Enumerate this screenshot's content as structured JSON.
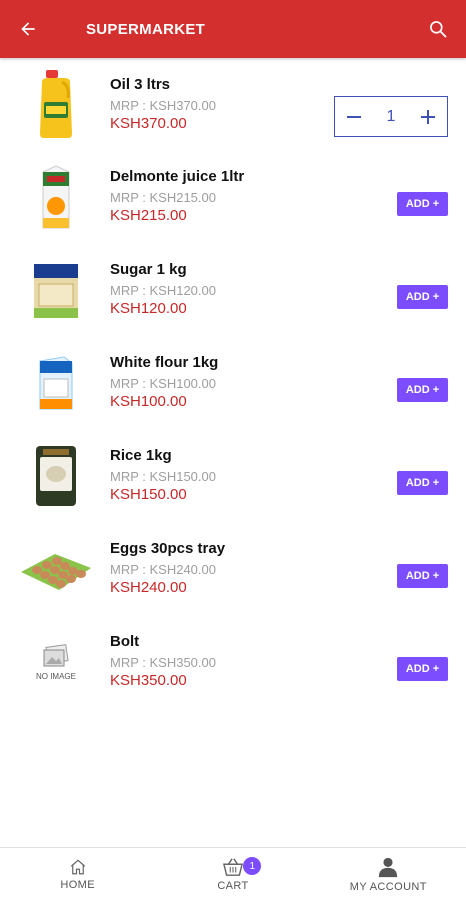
{
  "header": {
    "title": "SUPERMARKET",
    "background_color": "#d32f2f"
  },
  "products": [
    {
      "name": "Oil 3 ltrs",
      "mrp": "MRP :  KSH370.00",
      "price": "KSH370.00",
      "in_cart": true,
      "quantity": "1"
    },
    {
      "name": "Delmonte juice 1ltr",
      "mrp": "MRP :  KSH215.00",
      "price": "KSH215.00",
      "add_label": "ADD +"
    },
    {
      "name": "Sugar 1 kg",
      "mrp": "MRP :  KSH120.00",
      "price": "KSH120.00",
      "add_label": "ADD +"
    },
    {
      "name": "White flour 1kg",
      "mrp": "MRP :  KSH100.00",
      "price": "KSH100.00",
      "add_label": "ADD +"
    },
    {
      "name": "Rice 1kg",
      "mrp": "MRP :  KSH150.00",
      "price": "KSH150.00",
      "add_label": "ADD +"
    },
    {
      "name": "Eggs 30pcs tray",
      "mrp": "MRP :  KSH240.00",
      "price": "KSH240.00",
      "add_label": "ADD +"
    },
    {
      "name": "Bolt",
      "mrp": "MRP :  KSH350.00",
      "price": "KSH350.00",
      "add_label": "ADD +",
      "image_placeholder": "NO IMAGE"
    }
  ],
  "bottom_nav": {
    "home": "HOME",
    "cart": "CART",
    "cart_count": "1",
    "account": "MY ACCOUNT"
  },
  "colors": {
    "accent": "#7c4dff",
    "price": "#c62828",
    "stepper": "#3f51b5"
  }
}
